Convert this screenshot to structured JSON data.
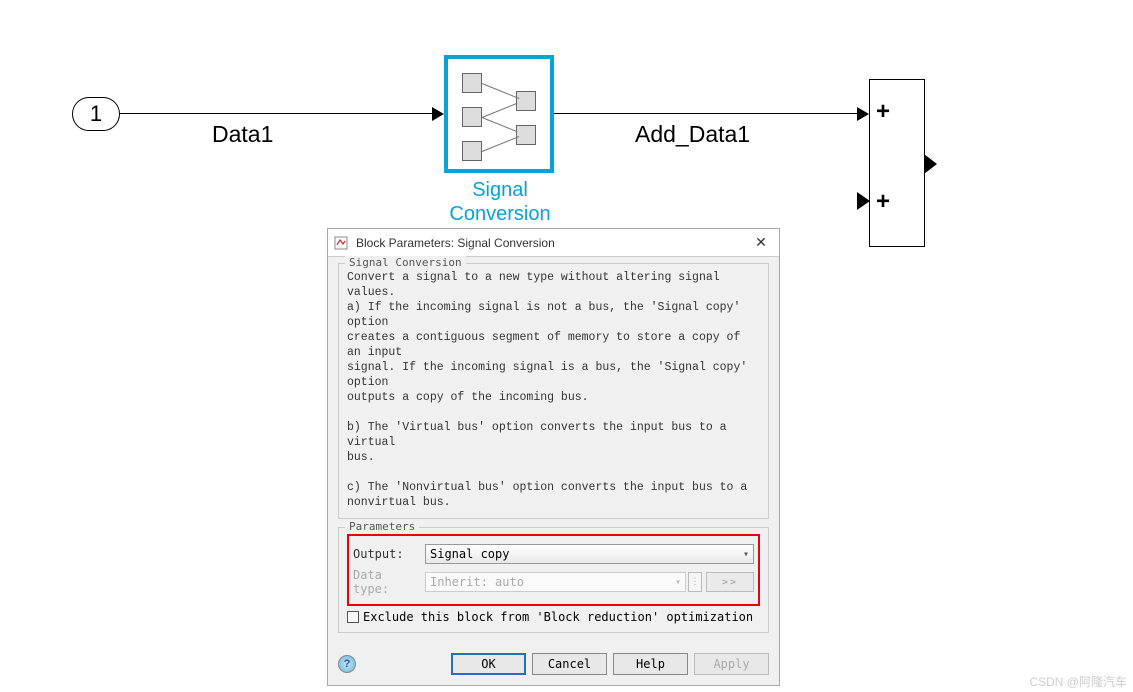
{
  "diagram": {
    "inport_label": "1",
    "signal1_label": "Data1",
    "block_label_line1": "Signal",
    "block_label_line2": "Conversion",
    "signal2_label": "Add_Data1",
    "sum_plus1": "+",
    "sum_plus2": "+"
  },
  "dialog": {
    "title": "Block Parameters: Signal Conversion",
    "close": "✕",
    "section1_title": "Signal Conversion",
    "desc": "Convert a signal to a new type without altering signal values.\na) If the incoming signal is not a bus, the 'Signal copy' option\ncreates a contiguous segment of memory to store a copy of an input\nsignal. If the incoming signal is a bus, the 'Signal copy' option\noutputs a copy of the incoming bus.\n\nb) The 'Virtual bus' option converts the input bus to a virtual\nbus.\n\nc) The 'Nonvirtual bus' option converts the input bus to a\nnonvirtual bus.",
    "section2_title": "Parameters",
    "output_label": "Output:",
    "output_value": "Signal copy",
    "datatype_label": "Data type:",
    "datatype_value": "Inherit: auto",
    "more_btn": "⋮",
    "gt_btn": ">>",
    "exclude_label": "Exclude this block from 'Block reduction' optimization",
    "help_icon": "?",
    "ok": "OK",
    "cancel": "Cancel",
    "help": "Help",
    "apply": "Apply"
  },
  "watermark": "CSDN @阿隆汽车"
}
